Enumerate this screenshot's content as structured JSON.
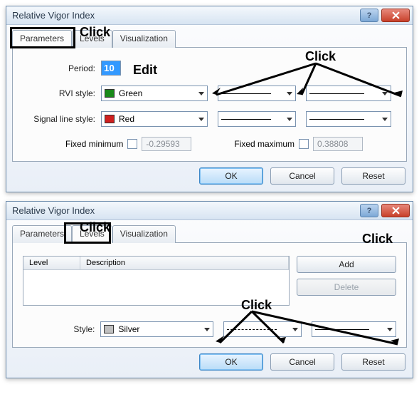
{
  "annotations": {
    "click": "Click",
    "edit": "Edit"
  },
  "dialog1": {
    "title": "Relative Vigor Index",
    "tabs": {
      "parameters": "Parameters",
      "levels": "Levels",
      "visualization": "Visualization"
    },
    "labels": {
      "period": "Period:",
      "rvi_style": "RVI style:",
      "signal_style": "Signal line style:",
      "fixed_min": "Fixed minimum",
      "fixed_max": "Fixed maximum"
    },
    "values": {
      "period": "10",
      "rvi_color_name": "Green",
      "rvi_color_hex": "#1a8a1a",
      "signal_color_name": "Red",
      "signal_color_hex": "#d02020",
      "fixed_min": "-0.29593",
      "fixed_max": "0.38808"
    },
    "buttons": {
      "ok": "OK",
      "cancel": "Cancel",
      "reset": "Reset"
    }
  },
  "dialog2": {
    "title": "Relative Vigor Index",
    "tabs": {
      "parameters": "Parameters",
      "levels": "Levels",
      "visualization": "Visualization"
    },
    "list": {
      "col_level": "Level",
      "col_desc": "Description"
    },
    "buttons": {
      "add": "Add",
      "delete": "Delete",
      "ok": "OK",
      "cancel": "Cancel",
      "reset": "Reset"
    },
    "labels": {
      "style": "Style:"
    },
    "values": {
      "style_color_name": "Silver",
      "style_color_hex": "#c0c0c0"
    }
  }
}
